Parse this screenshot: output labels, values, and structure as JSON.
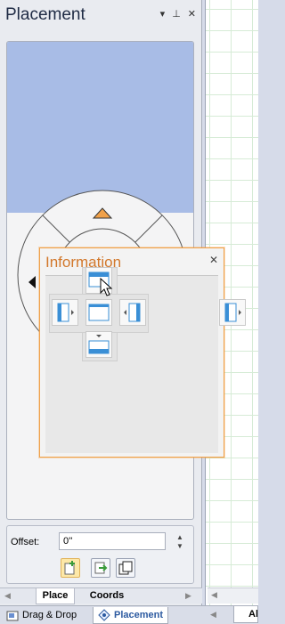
{
  "pane": {
    "title": "Placement",
    "controls": {
      "dropdown": "▾",
      "pin": "⊥",
      "close": "✕"
    }
  },
  "offset": {
    "label": "Offset:",
    "value": "0''"
  },
  "tabs": {
    "place": "Place",
    "coords": "Coords"
  },
  "bottom_tabs": {
    "drag_drop": "Drag & Drop",
    "placement": "Placement",
    "right": "All"
  },
  "dialog": {
    "title": "Information",
    "close": "✕"
  },
  "colors": {
    "accent_orange": "#f0a14a",
    "title_orange": "#d2782c",
    "canvas_blue": "#a8bce6",
    "icon_blue": "#3a8fd6"
  }
}
